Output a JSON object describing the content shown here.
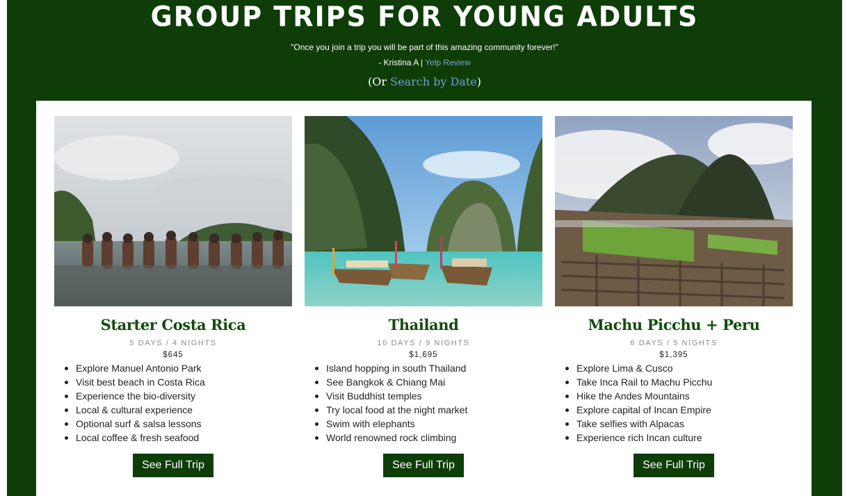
{
  "header": {
    "title": "Group Trips for Young Adults",
    "quote": "\"Once you join a trip you will be part of this amazing community forever!\"",
    "author": "- Kristina A |",
    "review_link": "Yelp Review",
    "search_prefix": "(Or",
    "search_link": "Search by Date",
    "search_suffix": ")"
  },
  "colors": {
    "brand_green": "#0e3d07",
    "title_green": "#124c0c",
    "link_blue": "#6f9fd6"
  },
  "trips": [
    {
      "title": "Starter Costa Rica",
      "duration": "5 Days / 4 Nights",
      "price": "$645",
      "features": [
        "Explore Manuel Antonio Park",
        "Visit best beach in Costa Rica",
        "Experience the bio-diversity",
        "Local & cultural experience",
        "Optional surf & salsa lessons",
        "Local coffee & fresh seafood"
      ],
      "button": "See Full Trip",
      "image_icon": "beach-group-photo"
    },
    {
      "title": "Thailand",
      "duration": "10 Days / 9 Nights",
      "price": "$1,695",
      "features": [
        "Island hopping in south Thailand",
        "See Bangkok & Chiang Mai",
        "Visit Buddhist temples",
        "Try local food at the night market",
        "Swim with elephants",
        "World renowned rock climbing"
      ],
      "button": "See Full Trip",
      "image_icon": "longtail-boats-photo"
    },
    {
      "title": "Machu Picchu + Peru",
      "duration": "6 Days / 5 Nights",
      "price": "$1,395",
      "features": [
        "Explore Lima & Cusco",
        "Take Inca Rail to Machu Picchu",
        "Hike the Andes Mountains",
        "Explore capital of Incan Empire",
        "Take selfies with Alpacas",
        "Experience rich Incan culture"
      ],
      "button": "See Full Trip",
      "image_icon": "machu-picchu-ruins-photo"
    }
  ]
}
